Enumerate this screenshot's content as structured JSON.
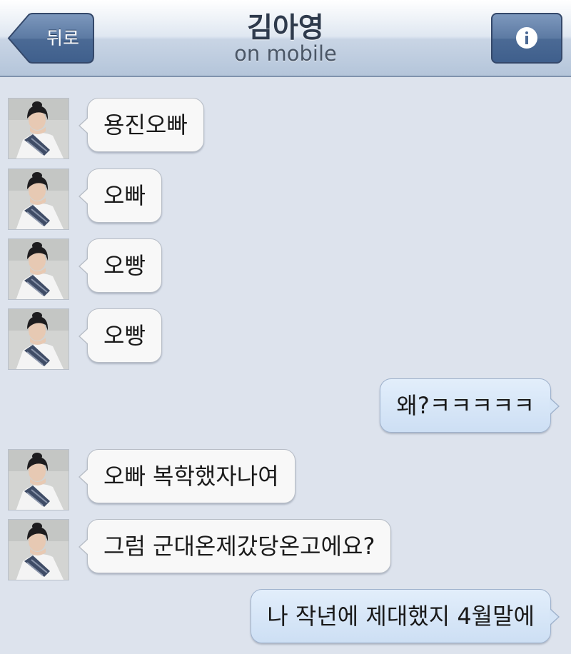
{
  "header": {
    "back_label": "뒤로",
    "contact_name": "김아영",
    "status": "on mobile",
    "info_icon": "info-icon"
  },
  "colors": {
    "background": "#dde3ed",
    "incoming_bubble": "#f8f8f8",
    "outgoing_bubble": "#d6e6f8",
    "nav_button": "#5a78a2"
  },
  "messages": [
    {
      "side": "left",
      "text": "용진오빠"
    },
    {
      "side": "left",
      "text": "오빠"
    },
    {
      "side": "left",
      "text": "오빵"
    },
    {
      "side": "left",
      "text": "오빵"
    },
    {
      "side": "right",
      "text": "왜?ㅋㅋㅋㅋㅋ"
    },
    {
      "side": "left",
      "text": "오빠 복학했자나여"
    },
    {
      "side": "left",
      "text": "그럼 군대온제갔당온고에요?"
    },
    {
      "side": "right",
      "text": "나 작년에 제대했지 4월말에"
    }
  ]
}
